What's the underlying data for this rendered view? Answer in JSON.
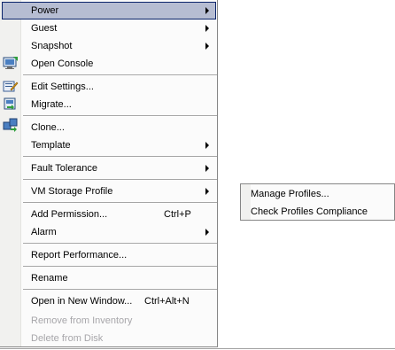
{
  "context_menu": {
    "items": [
      {
        "label": "Power",
        "has_submenu": true
      },
      {
        "label": "Guest",
        "has_submenu": true
      },
      {
        "label": "Snapshot",
        "has_submenu": true
      },
      {
        "label": "Open Console",
        "icon": "console-icon"
      },
      {
        "label": "Edit Settings...",
        "icon": "edit-settings-icon"
      },
      {
        "label": "Migrate...",
        "icon": "migrate-icon"
      },
      {
        "label": "Clone...",
        "icon": "clone-icon"
      },
      {
        "label": "Template",
        "has_submenu": true
      },
      {
        "label": "Fault Tolerance",
        "has_submenu": true
      },
      {
        "label": "VM Storage Profile",
        "has_submenu": true
      },
      {
        "label": "Add Permission...",
        "shortcut": "Ctrl+P"
      },
      {
        "label": "Alarm",
        "has_submenu": true
      },
      {
        "label": "Report Performance..."
      },
      {
        "label": "Rename"
      },
      {
        "label": "Open in New Window...",
        "shortcut": "Ctrl+Alt+N"
      },
      {
        "label": "Remove from Inventory",
        "disabled": true
      },
      {
        "label": "Delete from Disk",
        "disabled": true
      }
    ]
  },
  "submenu": {
    "parent": "VM Storage Profile",
    "items": [
      {
        "label": "Manage Profiles..."
      },
      {
        "label": "Check Profiles Compliance"
      }
    ]
  },
  "colors": {
    "highlight_fill": "#b6bdd2",
    "highlight_border": "#0a246a",
    "disabled_text": "#a7a6aa"
  }
}
